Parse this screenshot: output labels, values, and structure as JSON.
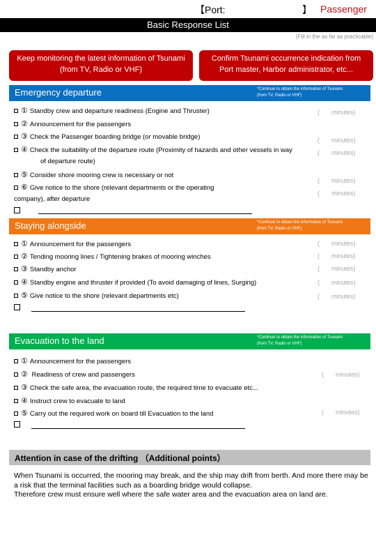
{
  "header": {
    "port_open": "【Port:",
    "port_close": "】",
    "category": "Passenger",
    "title": "Basic Response List",
    "fill_note": "(Fill in the as far as practicable)"
  },
  "info_boxes": [
    {
      "line1": "Keep monitoring the latest information of Tsunami",
      "line2": "(from TV, Radio or VHF)"
    },
    {
      "line1": "Confirm Tsunami occurrence indication from",
      "line2": "Port master, Harbor administrator, etc..."
    }
  ],
  "colors": {
    "red": "#c00000",
    "blue": "#0b6fbf",
    "orange": "#f07715",
    "green": "#00af50",
    "gray": "#bfbfbf",
    "passenger_red": "#b3121c"
  },
  "minutes_label": {
    "paren": "(",
    "text": "minutes)"
  },
  "sections": {
    "emergency": {
      "title": "Emergency departure",
      "note_line1": "*Continue to obtain the information of Tsunami",
      "note_line2": "(from TV, Radio or VHF)",
      "items": [
        {
          "num": "①",
          "text": "Standby crew and departure readiness (Engine and Thruster)"
        },
        {
          "num": "②",
          "text": "Announcement for the passengers"
        },
        {
          "num": "③",
          "text": "Check the Passenger boarding bridge (or movable bridge)"
        },
        {
          "num": "④",
          "text": "Check the suitability of the departure route (Proximity of hazards and other vessels in way",
          "cont": "of departure route)"
        },
        {
          "num": "⑤",
          "text": "Consider shore mooring crew is necessary or not"
        },
        {
          "num": "⑥",
          "text": "Give notice to the shore (relevant departments or the operating",
          "cont": "company), after departure"
        }
      ]
    },
    "staying": {
      "title": "Staying alongside",
      "note_line1": "*Continue to obtain the information of Tsunami",
      "note_line2": "(from TV, Radio or VHF)",
      "items": [
        {
          "num": "①",
          "text": "Announcement for the passengers"
        },
        {
          "num": "②",
          "text": "Tending mooring lines / Tightening brakes of mooring winches"
        },
        {
          "num": "③",
          "text": "Standby anchor"
        },
        {
          "num": "④",
          "text": "Standby engine and thruster if provided (To avoid damaging of lines, Surging)"
        },
        {
          "num": "⑤",
          "text": "Give notice to the shore (relevant departments etc)"
        }
      ]
    },
    "evacuation": {
      "title": "Evacuation to the land",
      "note_line1": "*Continue to obtain the information of Tsunami",
      "note_line2": "(from TV, Radio or VHF)",
      "items": [
        {
          "num": "①",
          "text": "Announcement for the passengers"
        },
        {
          "num": "②",
          "text": " Readiness of crew and passengers"
        },
        {
          "num": "③",
          "text": "Check the safe area, the evacuation route, the required time to evacuate etc..."
        },
        {
          "num": "④",
          "text": "Instruct crew to evacuate to land"
        },
        {
          "num": "⑤",
          "text": "Carry out the required work on board till Evacuation to the land"
        }
      ]
    },
    "drifting": {
      "title": "Attention in case of the drifting （Additional points）",
      "paragraph": "When Tsunami is occurred, the mooring may break, and the ship may drift from berth. And more there may be a risk that the terminal facilities such as a boarding bridge would collapse.",
      "paragraph2": "Therefore crew must ensure well where the safe water area and the evacuation area on land are."
    }
  }
}
